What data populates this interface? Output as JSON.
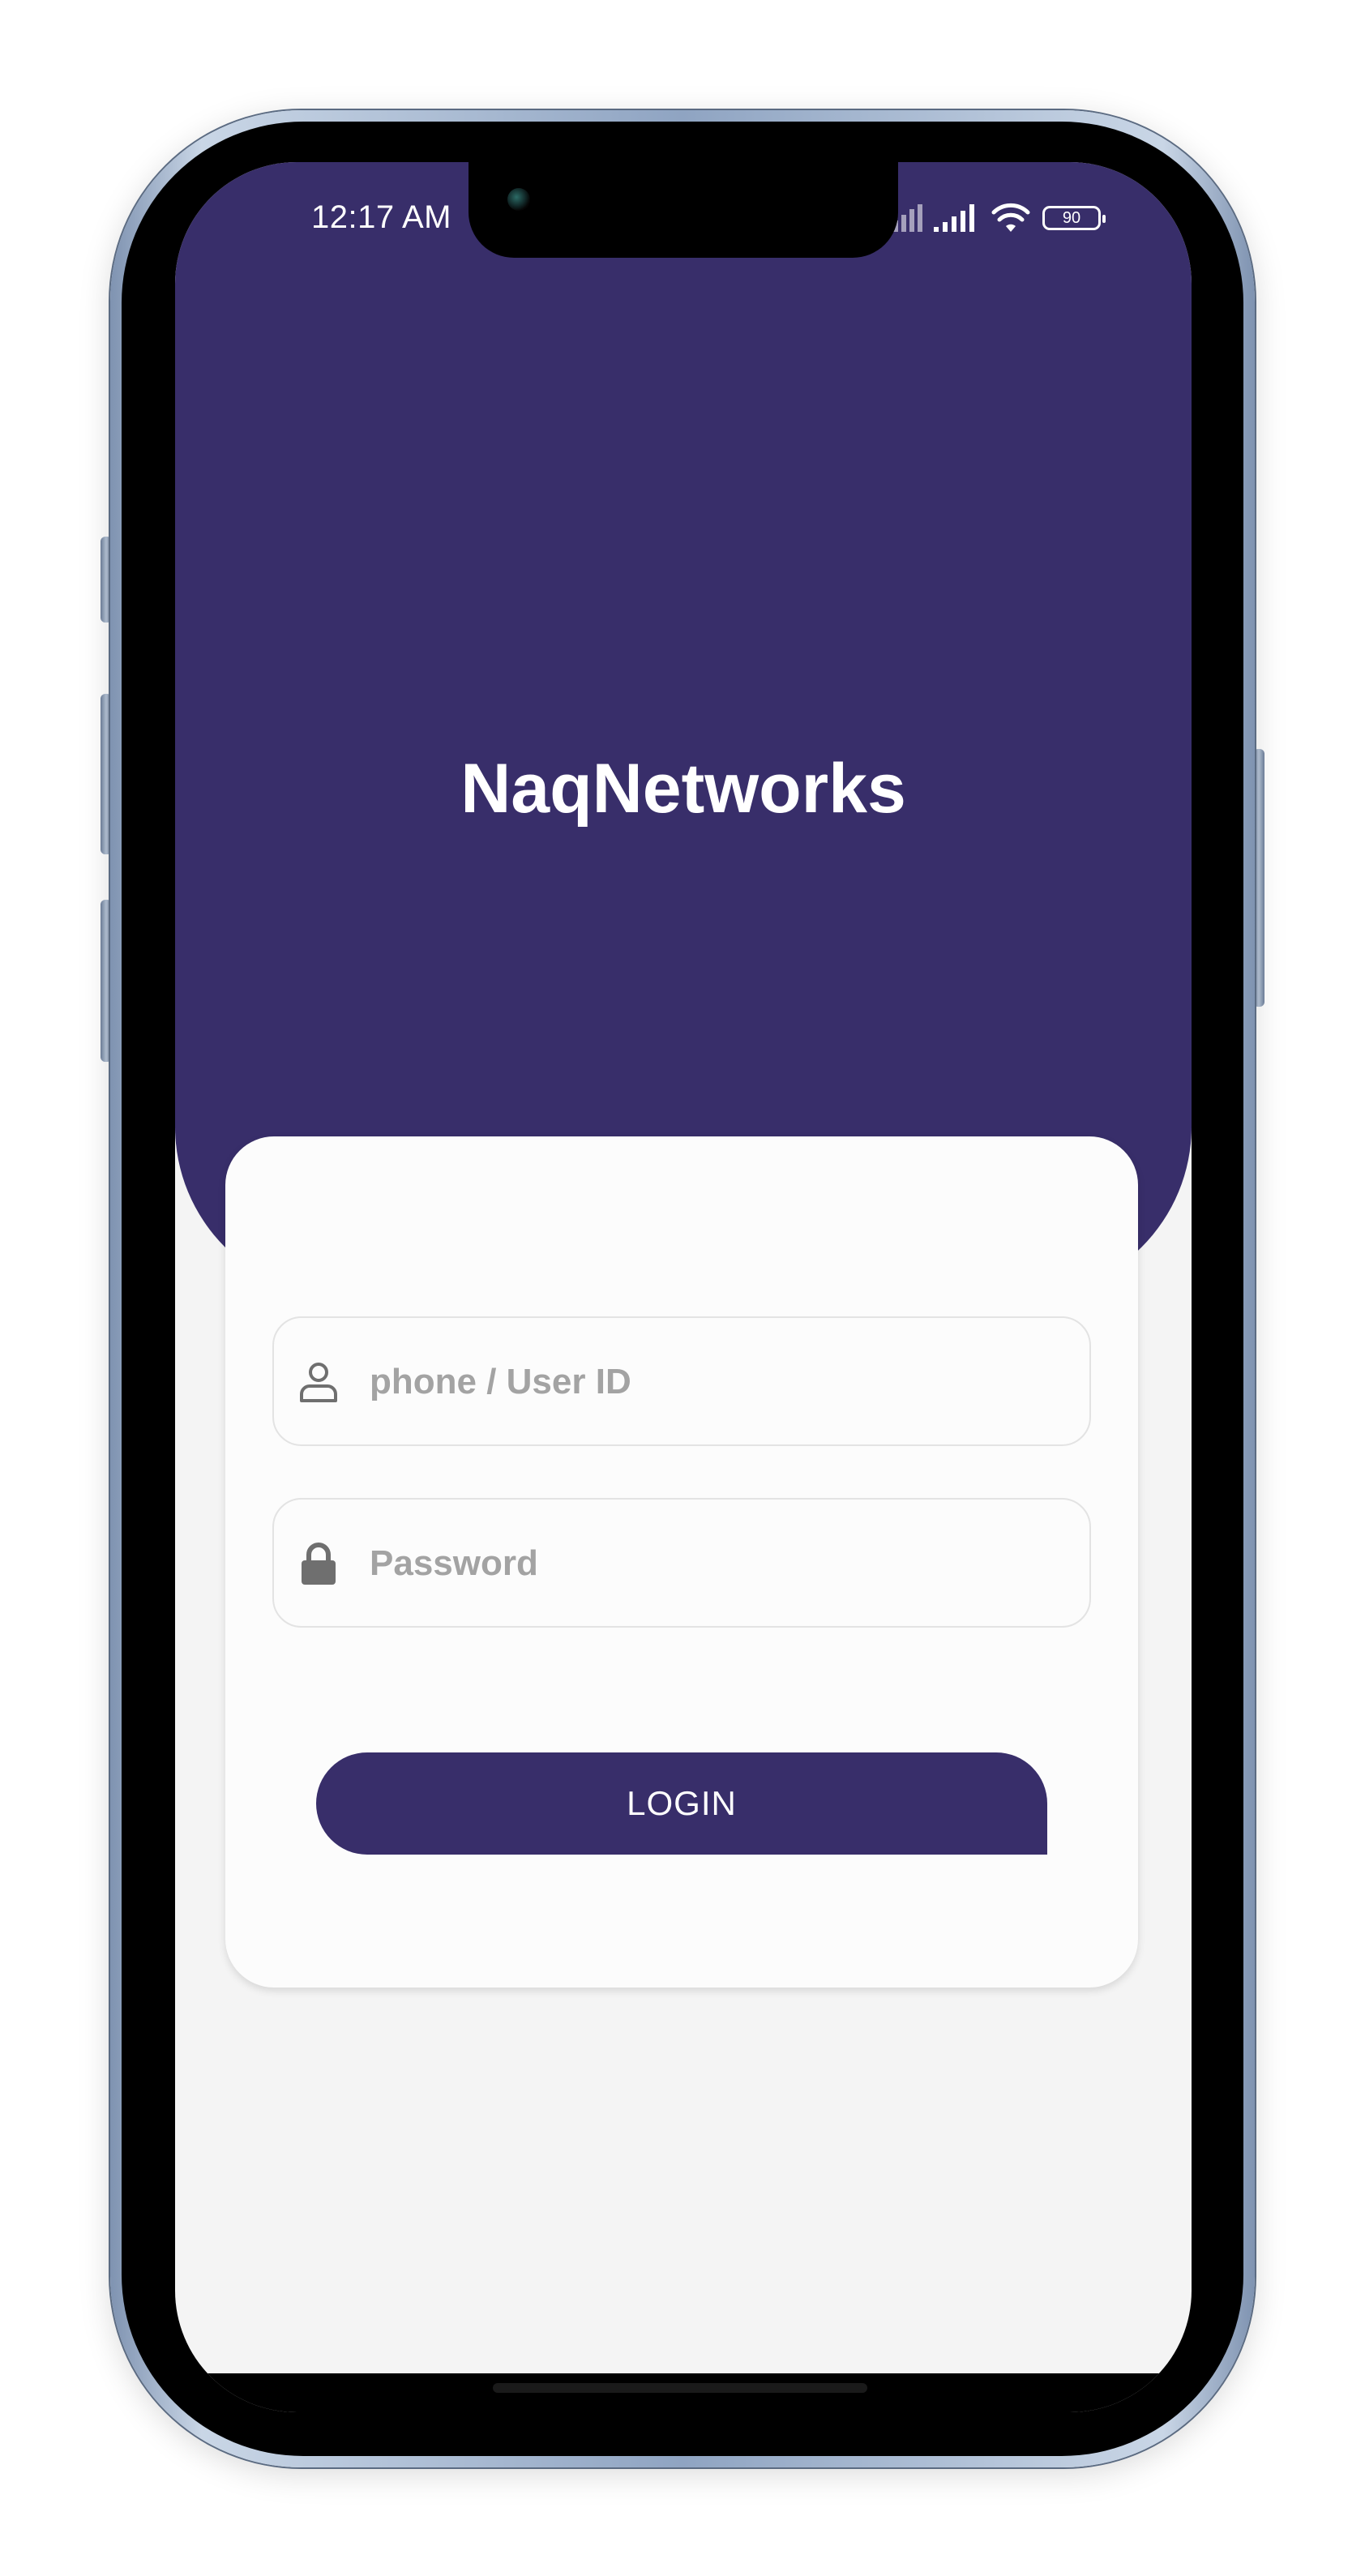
{
  "status_bar": {
    "time": "12:17 AM",
    "battery_level": "90",
    "icons": [
      "signal-icon",
      "signal-icon",
      "wifi-icon",
      "battery-icon"
    ]
  },
  "brand": {
    "name": "NaqNetworks"
  },
  "login": {
    "user_field": {
      "placeholder": "phone / User ID",
      "value": "",
      "icon": "user-icon"
    },
    "password_field": {
      "placeholder": "Password",
      "value": "",
      "icon": "lock-icon"
    },
    "button_label": "LOGIN"
  },
  "colors": {
    "primary": "#382e6a",
    "background": "#f4f4f4",
    "card": "#fcfcfc",
    "placeholder": "#a3a3a3"
  }
}
